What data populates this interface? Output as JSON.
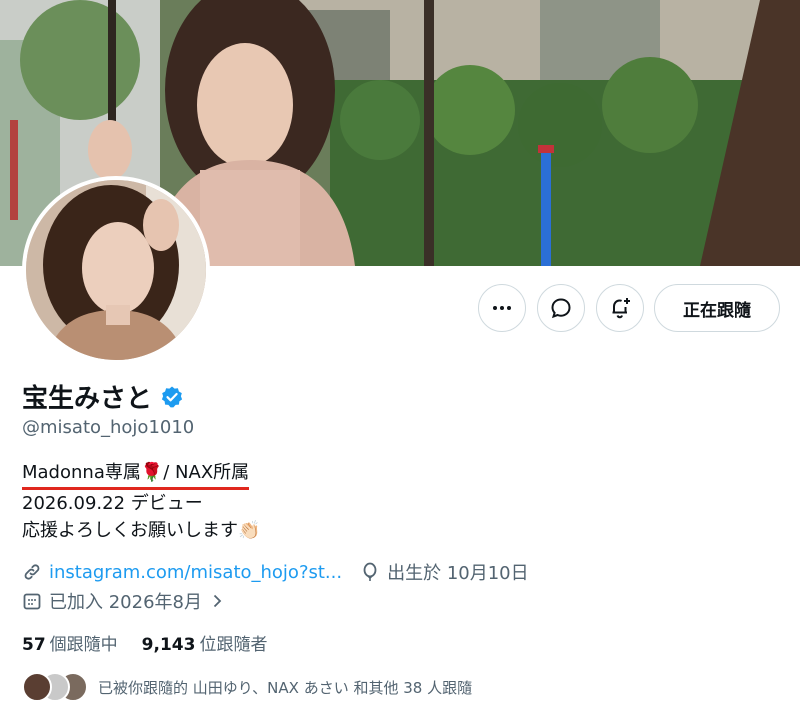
{
  "profile": {
    "display_name": "宝生みさと",
    "verified": true,
    "handle": "@misato_hojo1010",
    "bio": {
      "line1": "Madonna専属🌹/ NAX所属",
      "line2": "2026.09.22 デビュー",
      "line3": "応援よろしくお願いします👏🏻"
    },
    "link": "instagram.com/misato_hojo?st...",
    "birthday": "出生於 10月10日",
    "joined": "已加入 2026年8月"
  },
  "actions": {
    "more_icon": "more-icon",
    "message_icon": "message-icon",
    "notify_icon": "bell-add-icon",
    "follow_label": "正在跟隨"
  },
  "stats": {
    "following_count": "57",
    "following_label": "個跟隨中",
    "followers_count": "9,143",
    "followers_label": "位跟隨者"
  },
  "followed_by": {
    "text": "已被你跟隨的 山田ゆり、NAX あさい 和其他 38 人跟隨"
  },
  "colors": {
    "accent": "#1d9bf0",
    "verified": "#1d9bf0",
    "underline": "#e0281e",
    "secondary_text": "#536471"
  }
}
